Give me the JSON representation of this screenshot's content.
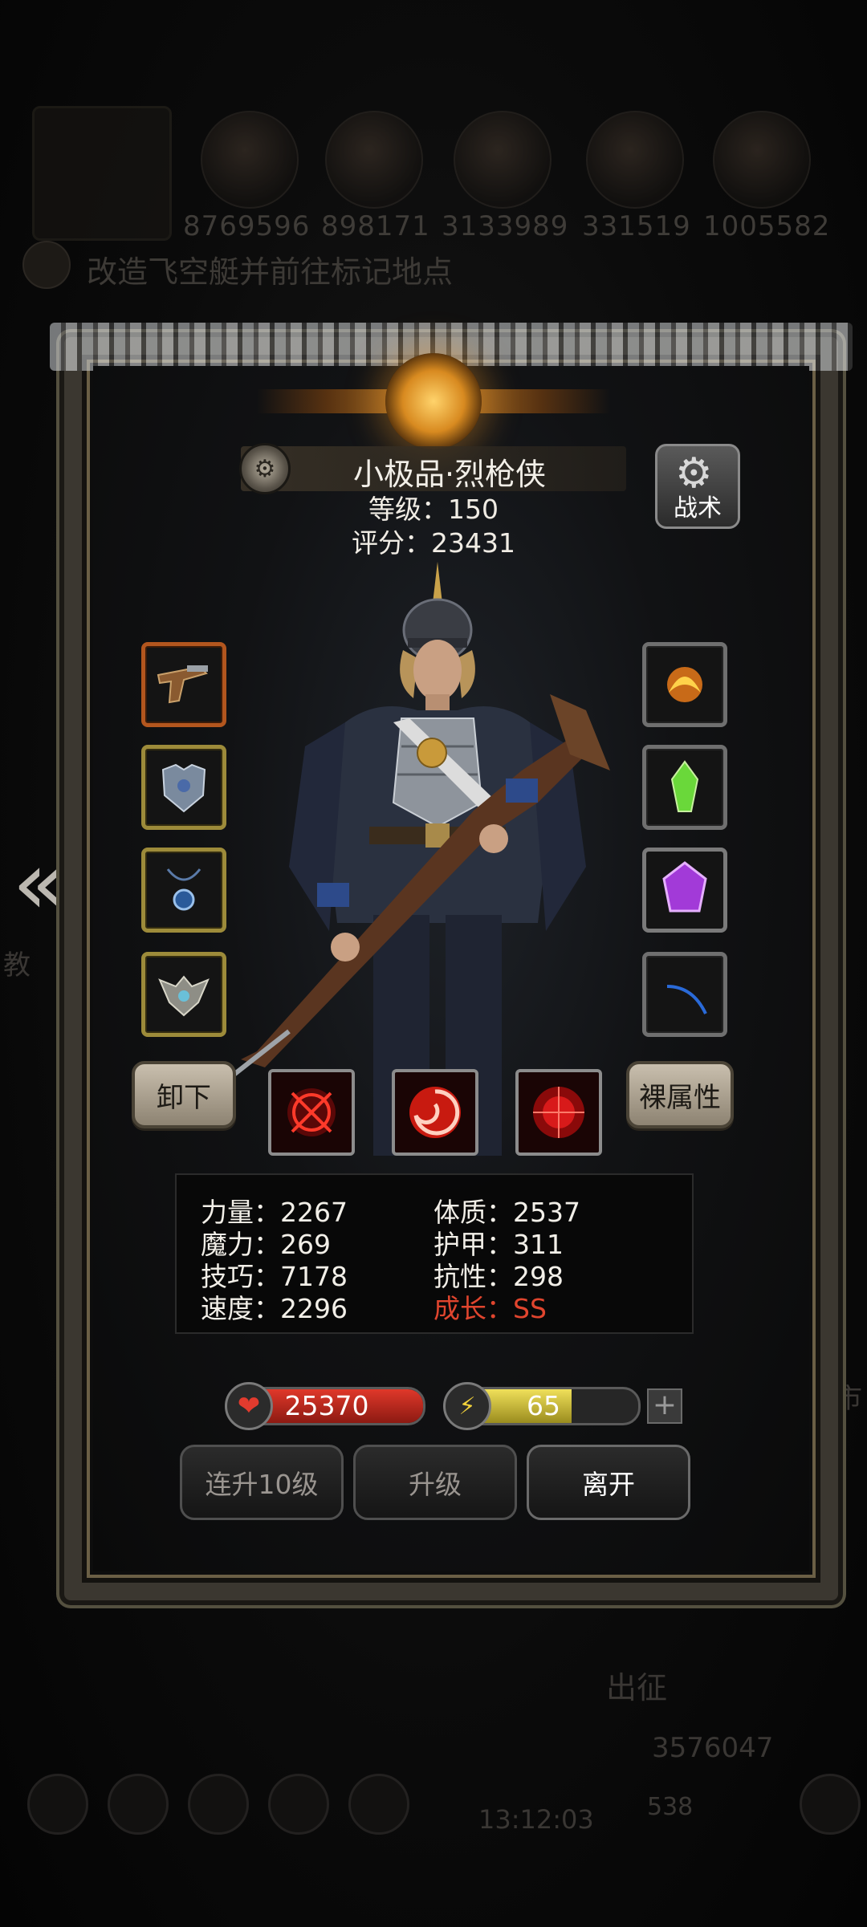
{
  "background": {
    "resources": [
      "8769596",
      "898171",
      "3133989",
      "331519",
      "1005582"
    ],
    "quest_text": "改造飞空艇并前往标记地点",
    "depart_label": "出征",
    "gold_amount": "3576047",
    "gem_amount": "538",
    "timer": "13:12:03",
    "left_edge_text": "教",
    "right_edge_text": "市"
  },
  "hero": {
    "name": "小极品·烈枪侠",
    "level": "等级：150",
    "score": "评分：23431"
  },
  "buttons": {
    "tactic": "战术",
    "unequip": "卸下",
    "base_attributes": "裸属性",
    "level_up_10": "连升10级",
    "level_up": "升级",
    "leave": "离开"
  },
  "stats": {
    "strength": "力量：2267",
    "constitution": "体质：2537",
    "magic": "魔力：269",
    "armor": "护甲：311",
    "skill": "技巧：7178",
    "resistance": "抗性：298",
    "speed": "速度：2296",
    "growth": "成长：SS"
  },
  "bars": {
    "hp_value": "25370",
    "hp_fraction": 1.0,
    "energy_value": "65",
    "energy_fraction": 0.65
  },
  "equipment": {
    "left": [
      "pistol-icon",
      "chest-armor-icon",
      "amulet-icon",
      "helm-crest-icon"
    ],
    "right": [
      "fire-relic-icon",
      "green-crystal-icon",
      "purple-gem-icon",
      "blue-feather-icon"
    ]
  },
  "colors": {
    "growth": "#e0452e",
    "slot_orange": "#b3561e",
    "slot_gold": "#9d8b3a",
    "hp": "#e0382a",
    "energy": "#f0e05a"
  }
}
